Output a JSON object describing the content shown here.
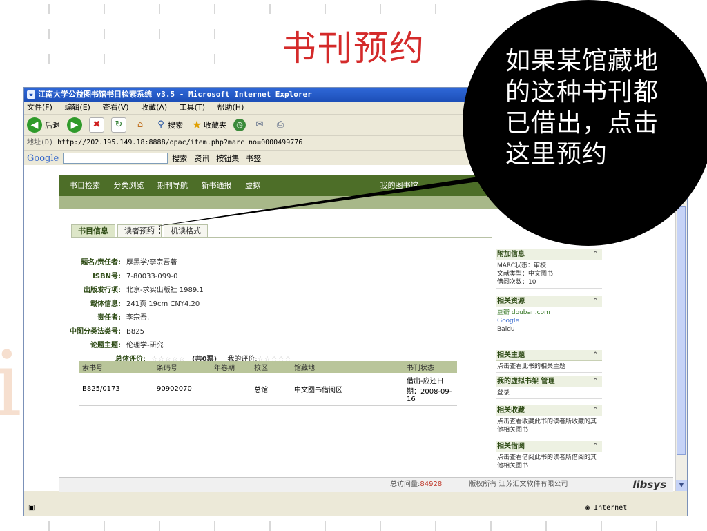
{
  "slide": {
    "title": "书刊预约",
    "callout": "如果某馆藏地的这种书刊都已借出，点击这里预约",
    "decoration_chars": [
      "吉",
      "i"
    ]
  },
  "browser": {
    "title": "江南大学公益图书馆书目检索系统 v3.5 - Microsoft Internet Explorer",
    "menu": [
      "文件(F)",
      "编辑(E)",
      "查看(V)",
      "收藏(A)",
      "工具(T)",
      "帮助(H)"
    ],
    "toolbar": {
      "back": "后退",
      "search": "搜索",
      "favorites": "收藏夹"
    },
    "address_label": "地址(D)",
    "address": "http://202.195.149.18:8888/opac/item.php?marc_no=0000499776",
    "google": {
      "logo": "Google",
      "search": "搜索",
      "news": "资讯",
      "bookmarks": "按钮集",
      "bookmark2": "书签"
    },
    "status_zone": "Internet"
  },
  "page": {
    "nav": [
      "书目检索",
      "分类浏览",
      "期刊导航",
      "新书通报",
      "虚拟",
      "我的图书馆"
    ],
    "tabs": [
      "书目信息",
      "读者预约",
      "机读格式"
    ],
    "fields": [
      {
        "k": "题名/责任者:",
        "v": "厚黑学/李宗吾著"
      },
      {
        "k": "ISBN号:",
        "v": "7-80033-099-0"
      },
      {
        "k": "出版发行项:",
        "v": "北京-求实出版社 1989.1"
      },
      {
        "k": "载体信息:",
        "v": "241页 19cm CNY4.20"
      },
      {
        "k": "责任者:",
        "v": "李宗吾,"
      },
      {
        "k": "中图分类法类号:",
        "v": "B825"
      },
      {
        "k": "论题主题:",
        "v": "伦理学-研究"
      }
    ],
    "rating": {
      "label": "总体评价:",
      "stars": "☆☆☆☆☆",
      "votes": "(共0票)",
      "my_label": "我的评价:",
      "my_stars": "☆☆☆☆☆"
    },
    "holdings": {
      "headers": [
        "索书号",
        "条码号",
        "年卷期",
        "校区",
        "馆藏地",
        "书刊状态"
      ],
      "rows": [
        [
          "B825/0173",
          "90902070",
          "",
          "总馆",
          "中文图书借阅区",
          "借出-应还日期：2008-09-16"
        ]
      ]
    },
    "right_panels": [
      {
        "title": "附加信息",
        "lines": [
          "MARC状态：审校",
          "文献类型：中文图书",
          "借阅次数：10"
        ]
      },
      {
        "title": "相关资源",
        "lines": [
          "豆瓣 douban.com",
          "Google",
          "Baidu"
        ]
      },
      {
        "title": "相关主题",
        "lines": [
          "点击查看此书的相关主题"
        ]
      },
      {
        "title": "我的虚拟书架 管理",
        "lines": [
          "登录"
        ]
      },
      {
        "title": "相关收藏",
        "lines": [
          "点击查看收藏此书的读者所收藏的其他相关图书"
        ]
      },
      {
        "title": "相关借阅",
        "lines": [
          "点击查看借阅此书的读者所借阅的其他相关图书"
        ]
      }
    ],
    "footer": {
      "visits_label": "总访问量:",
      "visits": "84928",
      "copyright": "版权所有 江苏汇文软件有限公司",
      "brand": "libsys"
    }
  }
}
